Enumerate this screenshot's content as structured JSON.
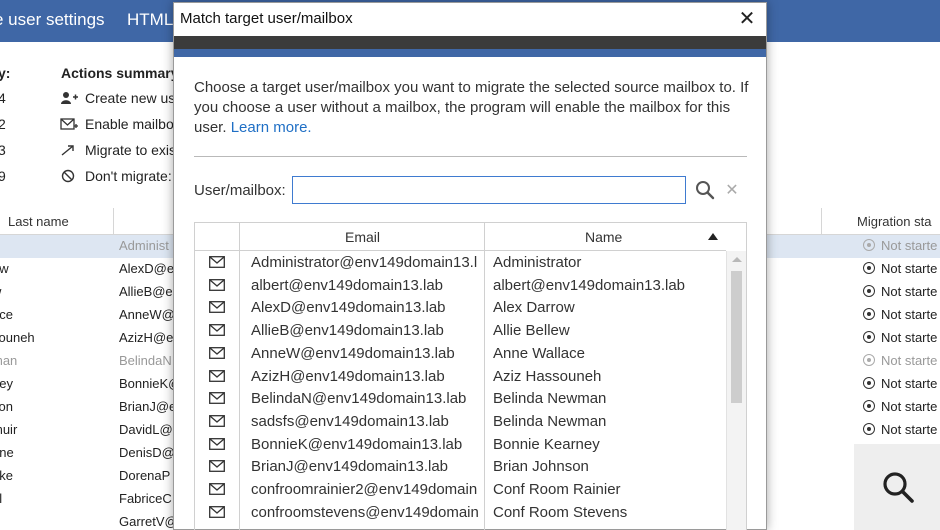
{
  "topbar": {
    "items": [
      "e user settings",
      "HTML"
    ]
  },
  "summary": {
    "left_heading": "y:",
    "title": "Actions summary",
    "rows": [
      {
        "count": "4",
        "icon": "add-user-icon",
        "text": "Create new use"
      },
      {
        "count": "2",
        "icon": "mailbox-icon",
        "text": "Enable mailbo"
      },
      {
        "count": "3",
        "icon": "migrate-arrow-icon",
        "text": "Migrate to exis"
      },
      {
        "count": "9",
        "icon": "block-icon",
        "text": "Don't migrate:"
      }
    ]
  },
  "grid": {
    "columns": {
      "last_name": "Last name",
      "migration_status": "Migration sta"
    },
    "rows": [
      {
        "last": "",
        "email": "Administ",
        "status": "Not starte",
        "selected": true,
        "dim": true
      },
      {
        "last": "ow",
        "email": "AlexD@e",
        "status": "Not starte"
      },
      {
        "last": "w",
        "email": "AllieB@e",
        "status": "Not starte"
      },
      {
        "last": "ace",
        "email": "AnneW@",
        "status": "Not starte"
      },
      {
        "last": "souneh",
        "email": "AzizH@e",
        "status": "Not starte"
      },
      {
        "last": "man",
        "email": "BelindaN",
        "status": "Not starte",
        "dim": true
      },
      {
        "last": "ney",
        "email": "BonnieK@",
        "status": "Not starte"
      },
      {
        "last": "son",
        "email": "BrianJ@e",
        "status": "Not starte"
      },
      {
        "last": "muir",
        "email": "DavidL@",
        "status": "Not starte"
      },
      {
        "last": "nne",
        "email": "DenisD@",
        "status": ""
      },
      {
        "last": "nke",
        "email": "DorenaP",
        "status": ""
      },
      {
        "last": "el",
        "email": "FabriceC",
        "status": ""
      },
      {
        "last": "",
        "email": "GarretV@",
        "status": ""
      }
    ]
  },
  "modal": {
    "title": "Match target user/mailbox",
    "close_label": "✕",
    "description": "Choose a target user/mailbox you want to migrate the selected source mailbox to. If you choose a user without a mailbox, the program will enable the mailbox for this user.",
    "learn_more": "Learn more.",
    "field_label": "User/mailbox:",
    "field_value": "",
    "clear_label": "✕",
    "table": {
      "col_email": "Email",
      "col_name": "Name",
      "sort": "ascending",
      "rows": [
        {
          "email": "Administrator@env149domain13.l",
          "name": "Administrator"
        },
        {
          "email": "albert@env149domain13.lab",
          "name": "albert@env149domain13.lab"
        },
        {
          "email": "AlexD@env149domain13.lab",
          "name": "Alex Darrow"
        },
        {
          "email": "AllieB@env149domain13.lab",
          "name": "Allie Bellew"
        },
        {
          "email": "AnneW@env149domain13.lab",
          "name": "Anne Wallace"
        },
        {
          "email": "AzizH@env149domain13.lab",
          "name": "Aziz Hassouneh"
        },
        {
          "email": "BelindaN@env149domain13.lab",
          "name": "Belinda Newman"
        },
        {
          "email": "sadsfs@env149domain13.lab",
          "name": "Belinda Newman"
        },
        {
          "email": "BonnieK@env149domain13.lab",
          "name": "Bonnie Kearney"
        },
        {
          "email": "BrianJ@env149domain13.lab",
          "name": "Brian Johnson"
        },
        {
          "email": "confroomrainier2@env149domain",
          "name": "Conf Room Rainier"
        },
        {
          "email": "confroomstevens@env149domain",
          "name": "Conf Room Stevens"
        }
      ]
    }
  },
  "colors": {
    "accent": "#3f67a6",
    "dark_bar": "#3b3b3b",
    "link": "#1f6fc5",
    "selected_row": "#dde6f2"
  },
  "zoom_button": {
    "icon": "magnifier-icon"
  }
}
